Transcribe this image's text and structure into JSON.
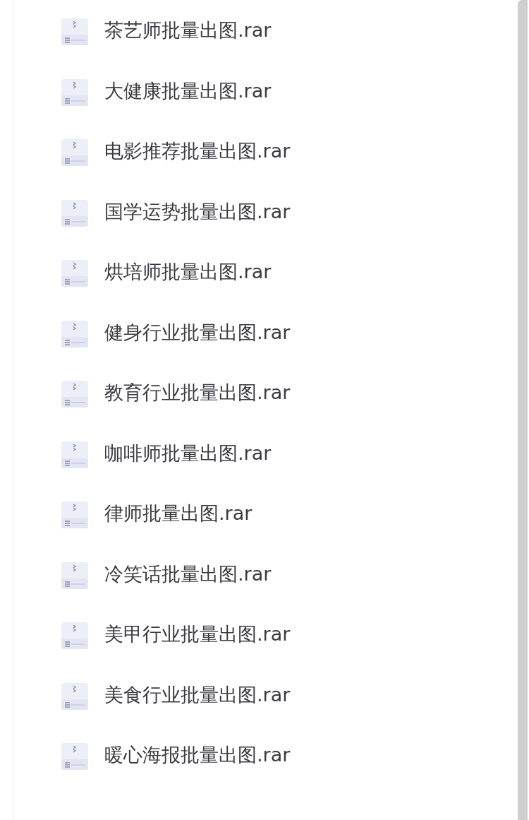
{
  "files": [
    {
      "name": "茶艺师批量出图.rar"
    },
    {
      "name": "大健康批量出图.rar"
    },
    {
      "name": "电影推荐批量出图.rar"
    },
    {
      "name": "国学运势批量出图.rar"
    },
    {
      "name": "烘培师批量出图.rar"
    },
    {
      "name": "健身行业批量出图.rar"
    },
    {
      "name": "教育行业批量出图.rar"
    },
    {
      "name": "咖啡师批量出图.rar"
    },
    {
      "name": "律师批量出图.rar"
    },
    {
      "name": "冷笑话批量出图.rar"
    },
    {
      "name": "美甲行业批量出图.rar"
    },
    {
      "name": "美食行业批量出图.rar"
    },
    {
      "name": "暖心海报批量出图.rar"
    }
  ]
}
